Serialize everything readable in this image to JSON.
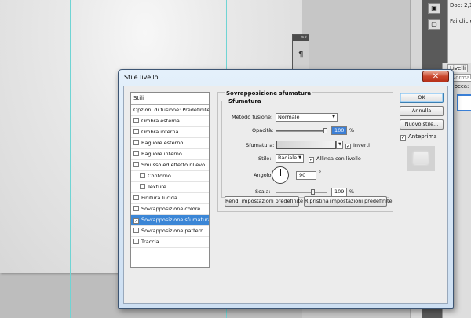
{
  "background": {
    "info_panel": {
      "line1": "Doc: 2,1",
      "line2": "Fai clic e"
    },
    "layers_panel": {
      "tab": "Livelli",
      "mode": "Normale",
      "lock": "Blocca:"
    },
    "mini_panel": {
      "glyph": "¶",
      "header": "»«"
    },
    "right_tools": {
      "icon1": "▣",
      "icon2": "▢"
    }
  },
  "dialog": {
    "title": "Stile livello",
    "close": "✕",
    "styles": {
      "header": "Stili",
      "items": [
        {
          "label": "Opzioni di fusione: Predefinite",
          "checkbox": false,
          "checked": false,
          "selected": false,
          "indent": false
        },
        {
          "label": "Ombra esterna",
          "checkbox": true,
          "checked": false,
          "selected": false,
          "indent": false
        },
        {
          "label": "Ombra interna",
          "checkbox": true,
          "checked": false,
          "selected": false,
          "indent": false
        },
        {
          "label": "Bagliore esterno",
          "checkbox": true,
          "checked": false,
          "selected": false,
          "indent": false
        },
        {
          "label": "Bagliore interno",
          "checkbox": true,
          "checked": false,
          "selected": false,
          "indent": false
        },
        {
          "label": "Smusso ed effetto rilievo",
          "checkbox": true,
          "checked": false,
          "selected": false,
          "indent": false
        },
        {
          "label": "Contorno",
          "checkbox": true,
          "checked": false,
          "selected": false,
          "indent": true
        },
        {
          "label": "Texture",
          "checkbox": true,
          "checked": false,
          "selected": false,
          "indent": true
        },
        {
          "label": "Finitura lucida",
          "checkbox": true,
          "checked": false,
          "selected": false,
          "indent": false
        },
        {
          "label": "Sovrapposizione colore",
          "checkbox": true,
          "checked": false,
          "selected": false,
          "indent": false
        },
        {
          "label": "Sovrapposizione sfumatura",
          "checkbox": true,
          "checked": true,
          "selected": true,
          "indent": false
        },
        {
          "label": "Sovrapposizione pattern",
          "checkbox": true,
          "checked": false,
          "selected": false,
          "indent": false
        },
        {
          "label": "Traccia",
          "checkbox": true,
          "checked": false,
          "selected": false,
          "indent": false
        }
      ]
    },
    "settings": {
      "group_title": "Sovrapposizione sfumatura",
      "subgroup_title": "Sfumatura",
      "blend_mode": {
        "label": "Metodo fusione:",
        "value": "Normale"
      },
      "opacity": {
        "label": "Opacità:",
        "value": "100",
        "unit": "%",
        "level": 1.0
      },
      "gradient": {
        "label": "Sfumatura:",
        "reverse_label": "Inverti",
        "reverse_checked": true
      },
      "style": {
        "label": "Stile:",
        "value": "Radiale",
        "align_label": "Allinea con livello",
        "align_checked": true
      },
      "angle": {
        "label": "Angolo:",
        "value": "90",
        "unit": "°"
      },
      "scale": {
        "label": "Scala:",
        "value": "109",
        "unit": "%",
        "level": 0.73
      },
      "make_default": "Rendi impostazioni predefinite",
      "reset_default": "Ripristina impostazioni predefinite"
    },
    "buttons": {
      "ok": "OK",
      "cancel": "Annulla",
      "new_style": "Nuovo stile..."
    },
    "preview": {
      "label": "Anteprima",
      "checked": true
    },
    "check_glyph": "✓",
    "arrow_glyph": "▼"
  }
}
